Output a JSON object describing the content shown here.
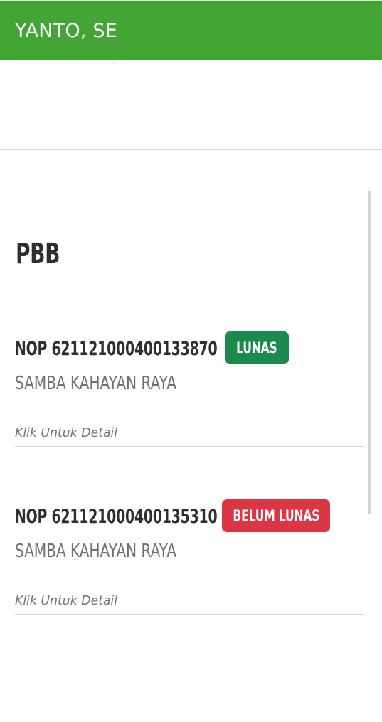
{
  "header": {
    "title": "YANTO, SE",
    "background": "#43a536"
  },
  "section": {
    "title": "PBB"
  },
  "pbb_items": [
    {
      "nop": "NOP 621121000400133870",
      "status": "LUNAS",
      "status_color": "#1b8a4d",
      "address": "SAMBA KAHAYAN RAYA",
      "detail_link": "Klik Untuk Detail"
    },
    {
      "nop": "NOP 621121000400135310",
      "status": "BELUM LUNAS",
      "status_color": "#dc3545",
      "address": "SAMBA KAHAYAN RAYA",
      "detail_link": "Klik Untuk Detail"
    }
  ]
}
